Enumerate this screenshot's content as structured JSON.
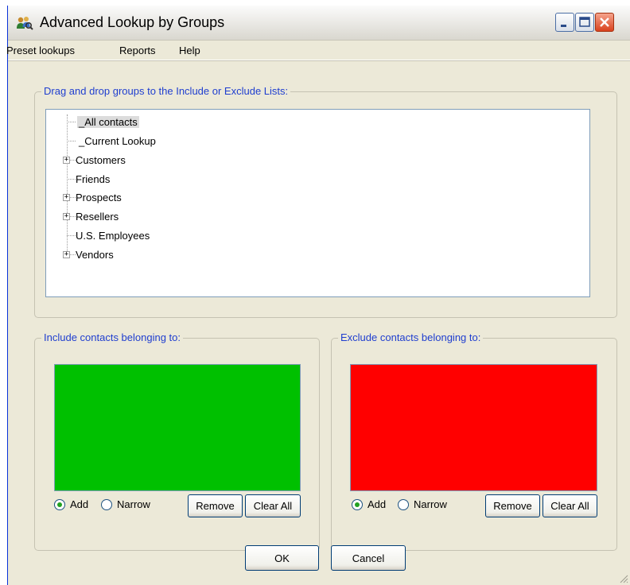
{
  "window": {
    "title": "Advanced Lookup by Groups",
    "icon": "people-search-icon",
    "controls": [
      "minimize-icon",
      "maximize-icon",
      "close-icon"
    ]
  },
  "menu": {
    "items": [
      "Preset lookups",
      "Reports",
      "Help"
    ]
  },
  "groups_panel": {
    "legend": "Drag and drop groups to the Include or Exclude Lists:",
    "tree": [
      {
        "label": "_All contacts",
        "expandable": false,
        "selected": true
      },
      {
        "label": "_Current Lookup",
        "expandable": false,
        "selected": false
      },
      {
        "label": "Customers",
        "expandable": true,
        "selected": false
      },
      {
        "label": "Friends",
        "expandable": false,
        "selected": false
      },
      {
        "label": "Prospects",
        "expandable": true,
        "selected": false
      },
      {
        "label": "Resellers",
        "expandable": true,
        "selected": false
      },
      {
        "label": "U.S. Employees",
        "expandable": false,
        "selected": false
      },
      {
        "label": "Vendors",
        "expandable": true,
        "selected": false
      }
    ]
  },
  "include_panel": {
    "legend": "Include contacts belonging to:",
    "list_color": "#00c000",
    "radio_add": "Add",
    "radio_narrow": "Narrow",
    "selected_mode": "Add",
    "remove_label": "Remove",
    "clear_label": "Clear All"
  },
  "exclude_panel": {
    "legend": "Exclude contacts belonging to:",
    "list_color": "#ff0000",
    "radio_add": "Add",
    "radio_narrow": "Narrow",
    "selected_mode": "Add",
    "remove_label": "Remove",
    "clear_label": "Clear All"
  },
  "footer": {
    "ok_label": "OK",
    "cancel_label": "Cancel"
  }
}
